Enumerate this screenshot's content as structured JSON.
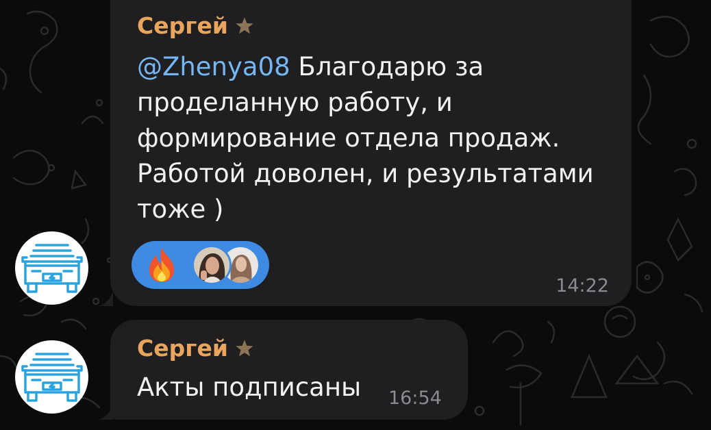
{
  "messages": [
    {
      "sender": "Сергей",
      "sender_badge_icon": "star-icon",
      "mention": "@Zhenya08",
      "text": " Благодарю за\nпроделанную работу, и\nформирование отдела продаж.\nРаботой доволен, и результатами\nтоже )",
      "time": "14:22",
      "reactions": [
        "fire-emoji",
        "reactor-avatar-woman-dark-hair",
        "reactor-avatar-woman-light-hair"
      ]
    },
    {
      "sender": "Сергей",
      "sender_badge_icon": "star-icon",
      "text": "Акты подписаны",
      "time": "16:54"
    }
  ],
  "avatar": {
    "icon": "electric-car-icon",
    "color": "#29a3e0"
  },
  "colors": {
    "sender_name": "#e9a55e",
    "mention": "#76b6f2",
    "bubble": "#1f1f21",
    "reaction_pill": "#3e8be3",
    "background": "#0b0b0c"
  }
}
